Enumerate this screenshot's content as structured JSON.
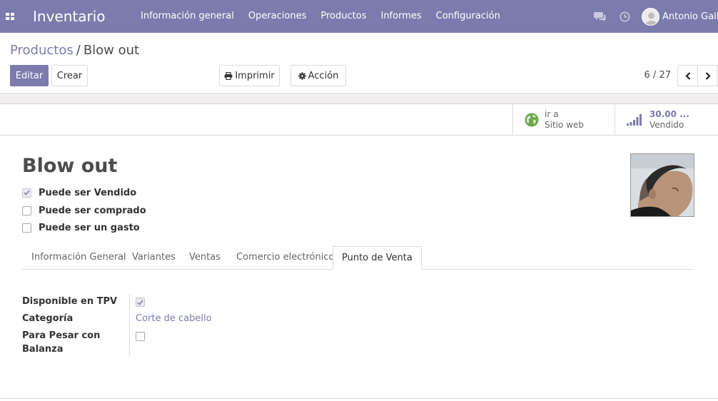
{
  "navbar": {
    "brand": "Inventario",
    "menu": [
      "Información general",
      "Operaciones",
      "Productos",
      "Informes",
      "Configuración"
    ],
    "user_name": "Antonio Galli",
    "icons": [
      "apps-grid-icon",
      "chat-icon",
      "clock-icon"
    ]
  },
  "control_panel": {
    "breadcrumb": {
      "parent": "Productos",
      "separator": "/",
      "current": "Blow out"
    },
    "edit_label": "Editar",
    "create_label": "Crear",
    "print_label": "Imprimir",
    "action_label": "Acción",
    "pager": "6 / 27"
  },
  "smart_buttons": {
    "website": {
      "line1": "ir a",
      "line2": "Sitio web"
    },
    "sold": {
      "value": "30.00 ...",
      "label": "Vendido"
    }
  },
  "product": {
    "name": "Blow out",
    "options": [
      {
        "label": "Puede ser Vendido",
        "checked": true
      },
      {
        "label": "Puede ser comprado",
        "checked": false
      },
      {
        "label": "Puede ser un gasto",
        "checked": false
      }
    ]
  },
  "tabs": [
    "Información General",
    "Variantes",
    "Ventas",
    "Comercio electrónico",
    "Punto de Venta"
  ],
  "active_tab": "Punto de Venta",
  "pos_fields": {
    "available_label": "Disponible en TPV",
    "available_checked": true,
    "category_label": "Categoría",
    "category_value": "Corte de cabello",
    "scale_label_line1": "Para Pesar con",
    "scale_label_line2": "Balanza",
    "scale_checked": false
  },
  "colors": {
    "brand": "#7c7bad",
    "text": "#4c4c4c",
    "border": "#dcdcdc"
  }
}
